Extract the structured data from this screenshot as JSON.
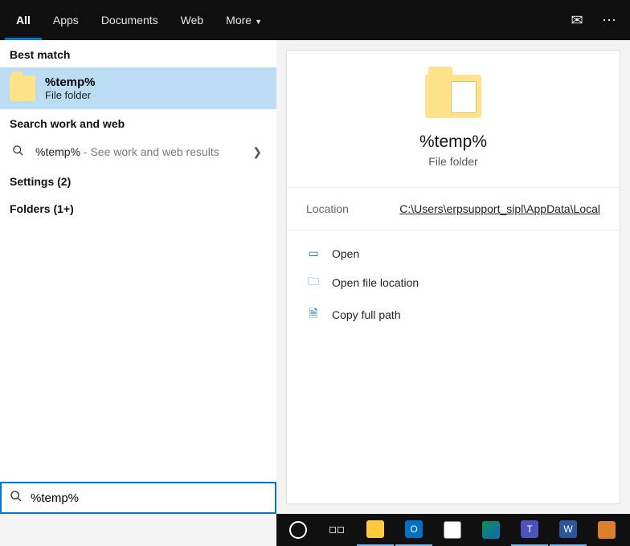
{
  "tabs": {
    "all": "All",
    "apps": "Apps",
    "docs": "Documents",
    "web": "Web",
    "more": "More"
  },
  "sections": {
    "best_match": "Best match",
    "search_web": "Search work and web",
    "settings": "Settings (2)",
    "folders": "Folders (1+)"
  },
  "best_match": {
    "title": "%temp%",
    "subtitle": "File folder"
  },
  "web_result": {
    "query": "%temp%",
    "hint": " - See work and web results"
  },
  "preview": {
    "title": "%temp%",
    "subtitle": "File folder",
    "location_label": "Location",
    "location_value": "C:\\Users\\erpsupport_sipl\\AppData\\Local",
    "actions": {
      "open": "Open",
      "open_loc": "Open file location",
      "copy_path": "Copy full path"
    }
  },
  "search": {
    "value": "%temp%"
  }
}
